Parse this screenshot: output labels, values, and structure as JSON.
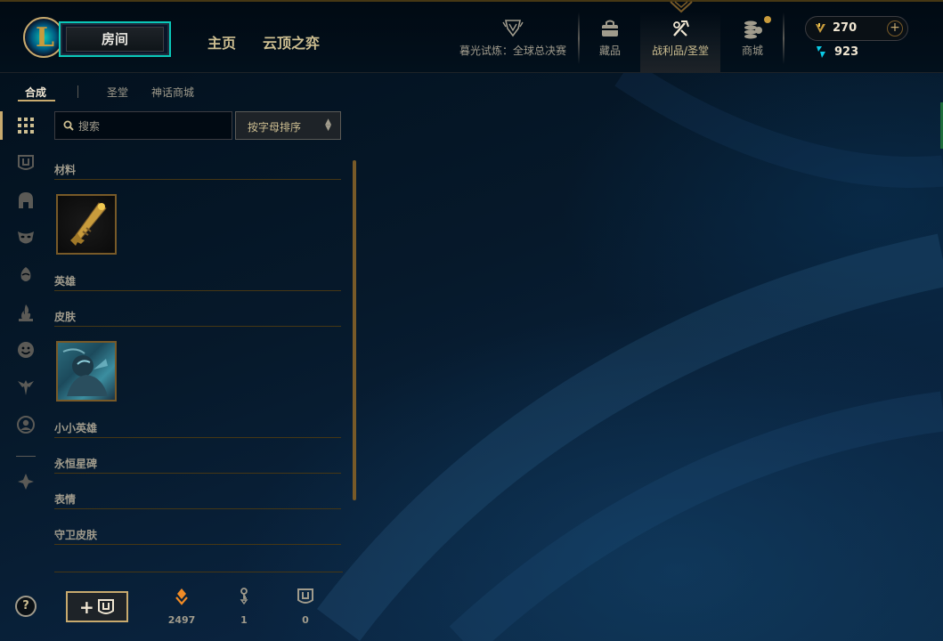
{
  "header": {
    "logo_letter": "L",
    "play_button_label": "房间",
    "nav_main": [
      {
        "label": "主页"
      },
      {
        "label": "云顶之弈"
      }
    ],
    "nav_buttons": [
      {
        "label": "暮光试炼：全球总决赛",
        "icon": "trophy-icon"
      },
      {
        "label": "藏品",
        "icon": "backpack-icon"
      },
      {
        "label": "战利品/圣堂",
        "icon": "loot-icon"
      },
      {
        "label": "商城",
        "icon": "coins-icon"
      }
    ],
    "rp_amount": "270",
    "be_amount": "923",
    "add_rp_label": "+"
  },
  "subnav": {
    "tabs": [
      {
        "label": "合成"
      },
      {
        "label": "圣堂"
      },
      {
        "label": "神话商城"
      }
    ]
  },
  "search": {
    "placeholder": "搜索",
    "value": ""
  },
  "sort": {
    "value": "按字母排序"
  },
  "categories": [
    {
      "label": "材料"
    },
    {
      "label": "英雄"
    },
    {
      "label": "皮肤"
    },
    {
      "label": "小小英雄"
    },
    {
      "label": "永恒星碑"
    },
    {
      "label": "表情"
    },
    {
      "label": "守卫皮肤"
    }
  ],
  "bottom": {
    "help_label": "?",
    "add_label": "+",
    "counters": [
      {
        "value": "2497",
        "icon": "orange-essence-icon"
      },
      {
        "value": "1",
        "icon": "key-fragment-icon"
      },
      {
        "value": "0",
        "icon": "chest-icon"
      }
    ]
  },
  "colors": {
    "gold": "#c8aa6e",
    "dark_gold": "#785a28",
    "teal": "#0ac8b9",
    "text": "#a09b8c",
    "text_bright": "#f0e6d2",
    "background": "#010a13",
    "orange_essence": "#f08b26",
    "blue_essence": "#0acbe6"
  }
}
